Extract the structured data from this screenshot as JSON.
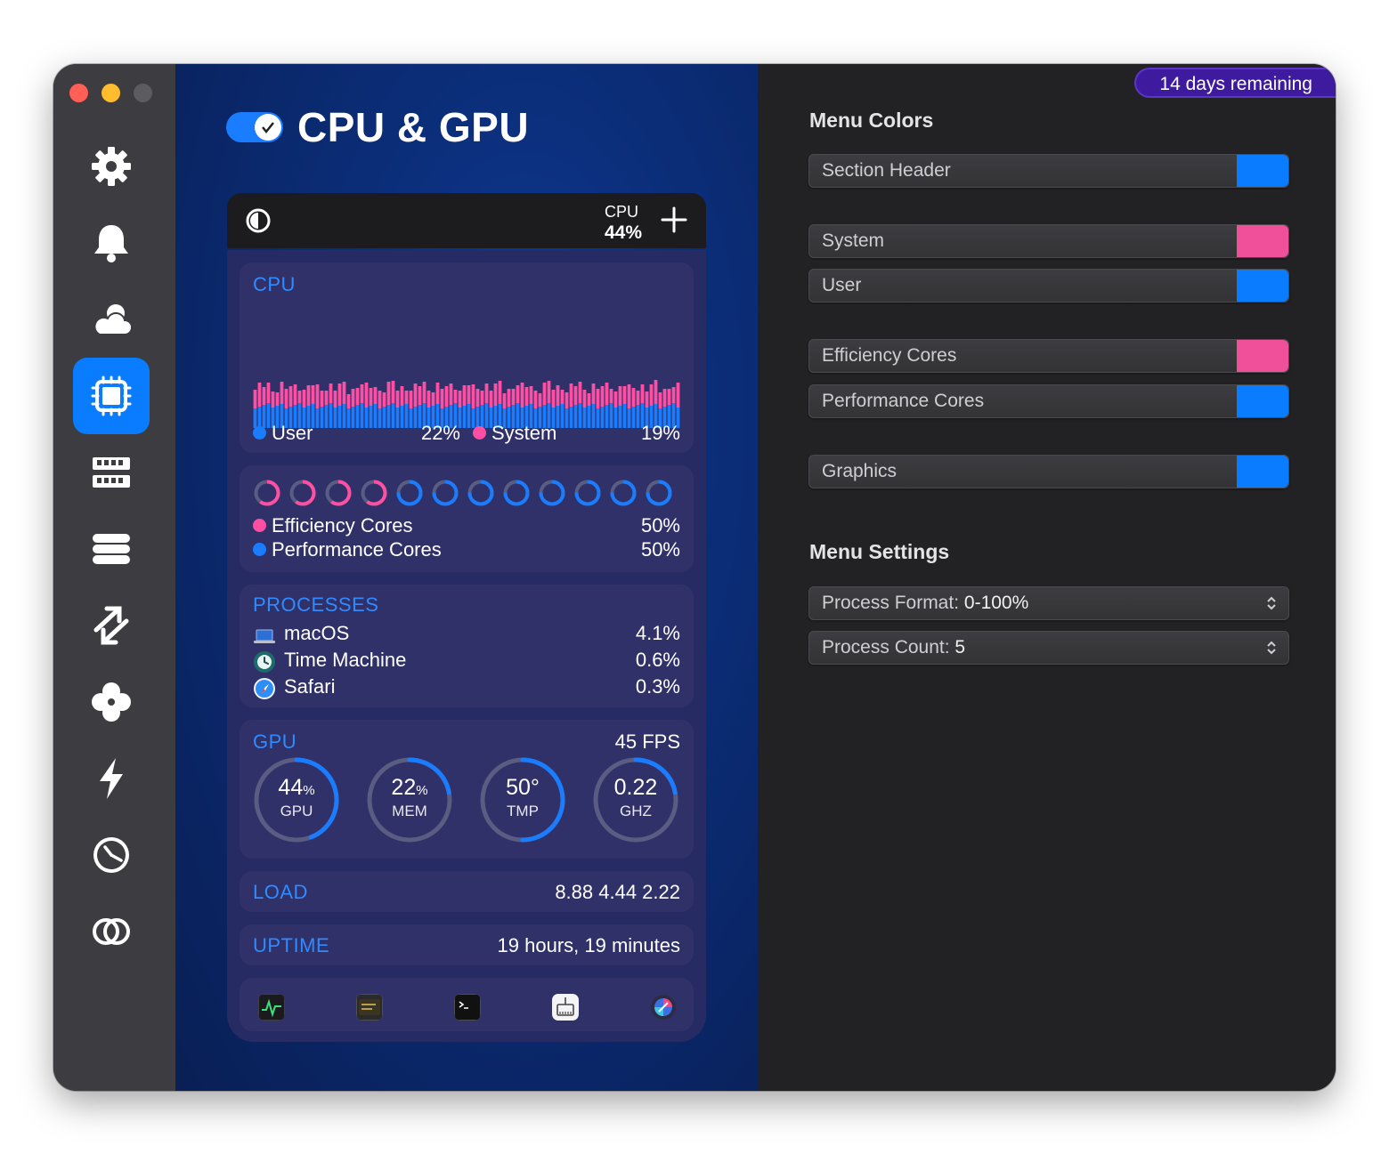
{
  "window": {
    "title": "CPU & GPU",
    "enabled": true
  },
  "sidebar": {
    "items": [
      {
        "name": "settings",
        "icon": "gear-icon",
        "active": false
      },
      {
        "name": "notifications",
        "icon": "bell-icon",
        "active": false
      },
      {
        "name": "weather",
        "icon": "cloud-sun-icon",
        "active": false
      },
      {
        "name": "cpu-gpu",
        "icon": "chip-icon",
        "active": true
      },
      {
        "name": "memory",
        "icon": "ram-icon",
        "active": false
      },
      {
        "name": "disks",
        "icon": "disk-stack-icon",
        "active": false
      },
      {
        "name": "network",
        "icon": "arrows-icon",
        "active": false
      },
      {
        "name": "sensors",
        "icon": "fan-icon",
        "active": false
      },
      {
        "name": "battery",
        "icon": "bolt-icon",
        "active": false
      },
      {
        "name": "time",
        "icon": "clock-icon",
        "active": false
      },
      {
        "name": "bluetooth",
        "icon": "rings-icon",
        "active": false
      }
    ]
  },
  "menubar": {
    "icon": "half-circle-icon",
    "cpu_label": "CPU",
    "cpu_value": "44%",
    "add_icon": "plus-icon"
  },
  "cpu": {
    "title": "CPU",
    "user_label": "User",
    "user_value": "22%",
    "system_label": "System",
    "system_value": "19%",
    "user_color": "#1a7cff",
    "system_color": "#ff4fa3"
  },
  "cores": {
    "efficiency_label": "Efficiency Cores",
    "efficiency_value": "50%",
    "performance_label": "Performance Cores",
    "performance_value": "50%",
    "efficiency_count": 4,
    "performance_count": 8
  },
  "processes": {
    "title": "PROCESSES",
    "items": [
      {
        "name": "macOS",
        "value": "4.1%",
        "icon": "laptop-icon"
      },
      {
        "name": "Time Machine",
        "value": "0.6%",
        "icon": "time-machine-icon"
      },
      {
        "name": "Safari",
        "value": "0.3%",
        "icon": "safari-icon"
      }
    ]
  },
  "gpu": {
    "title": "GPU",
    "fps": "45 FPS",
    "gauges": [
      {
        "value": "44",
        "unit": "%",
        "label": "GPU",
        "fraction": 0.44
      },
      {
        "value": "22",
        "unit": "%",
        "label": "MEM",
        "fraction": 0.22
      },
      {
        "value": "50°",
        "unit": "",
        "label": "TMP",
        "fraction": 0.5
      },
      {
        "value": "0.22",
        "unit": "",
        "label": "GHZ",
        "fraction": 0.22
      }
    ]
  },
  "load": {
    "title": "LOAD",
    "value": "8.88 4.44 2.22"
  },
  "uptime": {
    "title": "UPTIME",
    "value": "19 hours, 19 minutes"
  },
  "dock": {
    "apps": [
      {
        "name": "activity-monitor-icon"
      },
      {
        "name": "console-icon"
      },
      {
        "name": "terminal-icon"
      },
      {
        "name": "system-information-icon"
      },
      {
        "name": "istat-icon"
      }
    ]
  },
  "trial": {
    "text": "14 days remaining"
  },
  "menu_colors": {
    "title": "Menu Colors",
    "rows": [
      {
        "label": "Section Header",
        "color": "#0a7cff"
      },
      {
        "label": "System",
        "color": "#f0509a"
      },
      {
        "label": "User",
        "color": "#0a7cff"
      },
      {
        "label": "Efficiency Cores",
        "color": "#f0509a"
      },
      {
        "label": "Performance Cores",
        "color": "#0a7cff"
      },
      {
        "label": "Graphics",
        "color": "#0a7cff"
      }
    ]
  },
  "menu_settings": {
    "title": "Menu Settings",
    "process_format_label": "Process Format:",
    "process_format_value": "0-100%",
    "process_count_label": "Process Count:",
    "process_count_value": "5"
  }
}
